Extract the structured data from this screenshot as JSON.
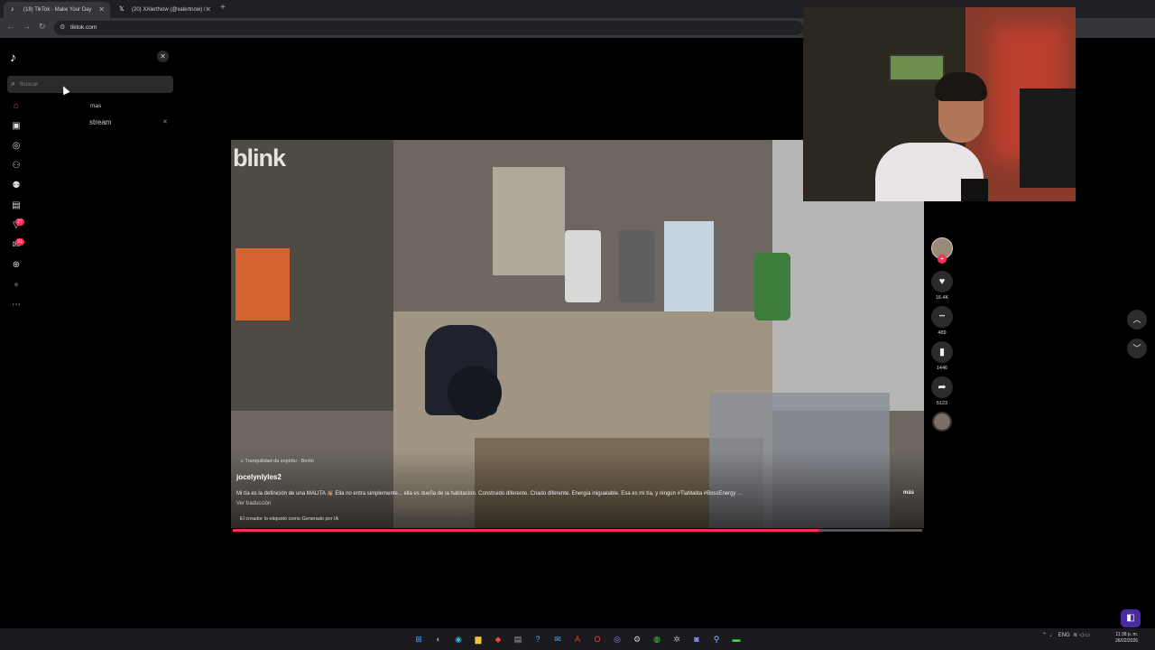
{
  "browser": {
    "tabs": [
      {
        "title": "(18) TikTok - Make Your Day",
        "favicon": "tiktok-icon"
      },
      {
        "title": "(20) XAlertNow (@xalertnow) /",
        "favicon": "x-icon"
      }
    ],
    "new_tab": "+",
    "url": "tiktok.com",
    "nav": {
      "back": "←",
      "forward": "→",
      "reload": "↻",
      "tune": "⚙"
    }
  },
  "sidebar": {
    "logo": "♪",
    "close": "✕",
    "search_placeholder": "Buscar",
    "history": [
      "mas",
      "stream"
    ],
    "history_remove": "✕",
    "icons": [
      {
        "name": "home-icon",
        "glyph": "⌂"
      },
      {
        "name": "shop-icon",
        "glyph": "▣"
      },
      {
        "name": "explore-icon",
        "glyph": "◎"
      },
      {
        "name": "following-icon",
        "glyph": "⚇"
      },
      {
        "name": "friends-icon",
        "glyph": "⚉"
      },
      {
        "name": "live-icon",
        "glyph": "▤"
      },
      {
        "name": "activity-icon",
        "glyph": "▽",
        "badge": "27"
      },
      {
        "name": "messages-icon",
        "glyph": "✉",
        "badge": "31"
      },
      {
        "name": "upload-icon",
        "glyph": "⊕"
      },
      {
        "name": "profile-icon",
        "glyph": "●"
      },
      {
        "name": "more-icon",
        "glyph": "⋯"
      }
    ]
  },
  "video": {
    "watermark": "blink",
    "music": "♫ Tranquilidad da espíritu · Berlin",
    "author": "jocelynlyles2",
    "caption": "Mi tía es la definición de una MALITA 👏🏽 Ella no entra simplemente... ella es dueña de la habitación. Construido diferente. Criado diferente. Energía inigualable. Esa es mi tía, y ningún #TiaMalita #BossEnergy ...",
    "more": "más",
    "translate": "Ver traducción",
    "ai_label": "El creador lo etiquetó como Generado por IA",
    "progress": 0.85
  },
  "actions": {
    "follow": "+",
    "like": {
      "glyph": "♥",
      "count": "16.4K"
    },
    "comment": {
      "glyph": "•••",
      "count": "489"
    },
    "save": {
      "glyph": "▮",
      "count": "1446"
    },
    "share": {
      "glyph": "➦",
      "count": "5123"
    },
    "prev": "︿",
    "next": "﹀"
  },
  "taskbar": {
    "icons": [
      "windows-icon",
      "copilot-icon",
      "edge-icon",
      "files-icon",
      "gem-icon",
      "store-icon",
      "help-icon",
      "mail-icon",
      "acrobat-icon",
      "opera-icon",
      "obs-icon",
      "settings-icon",
      "chrome-icon",
      "gear-icon",
      "discord-icon",
      "steam-icon",
      "terminal-icon"
    ],
    "tray_lang": "ENG",
    "time": "11:38 p. m.",
    "date": "26/02/2026"
  },
  "colors": {
    "accent": "#fe2c55",
    "background": "#000000",
    "panel": "#2a2a2a"
  }
}
